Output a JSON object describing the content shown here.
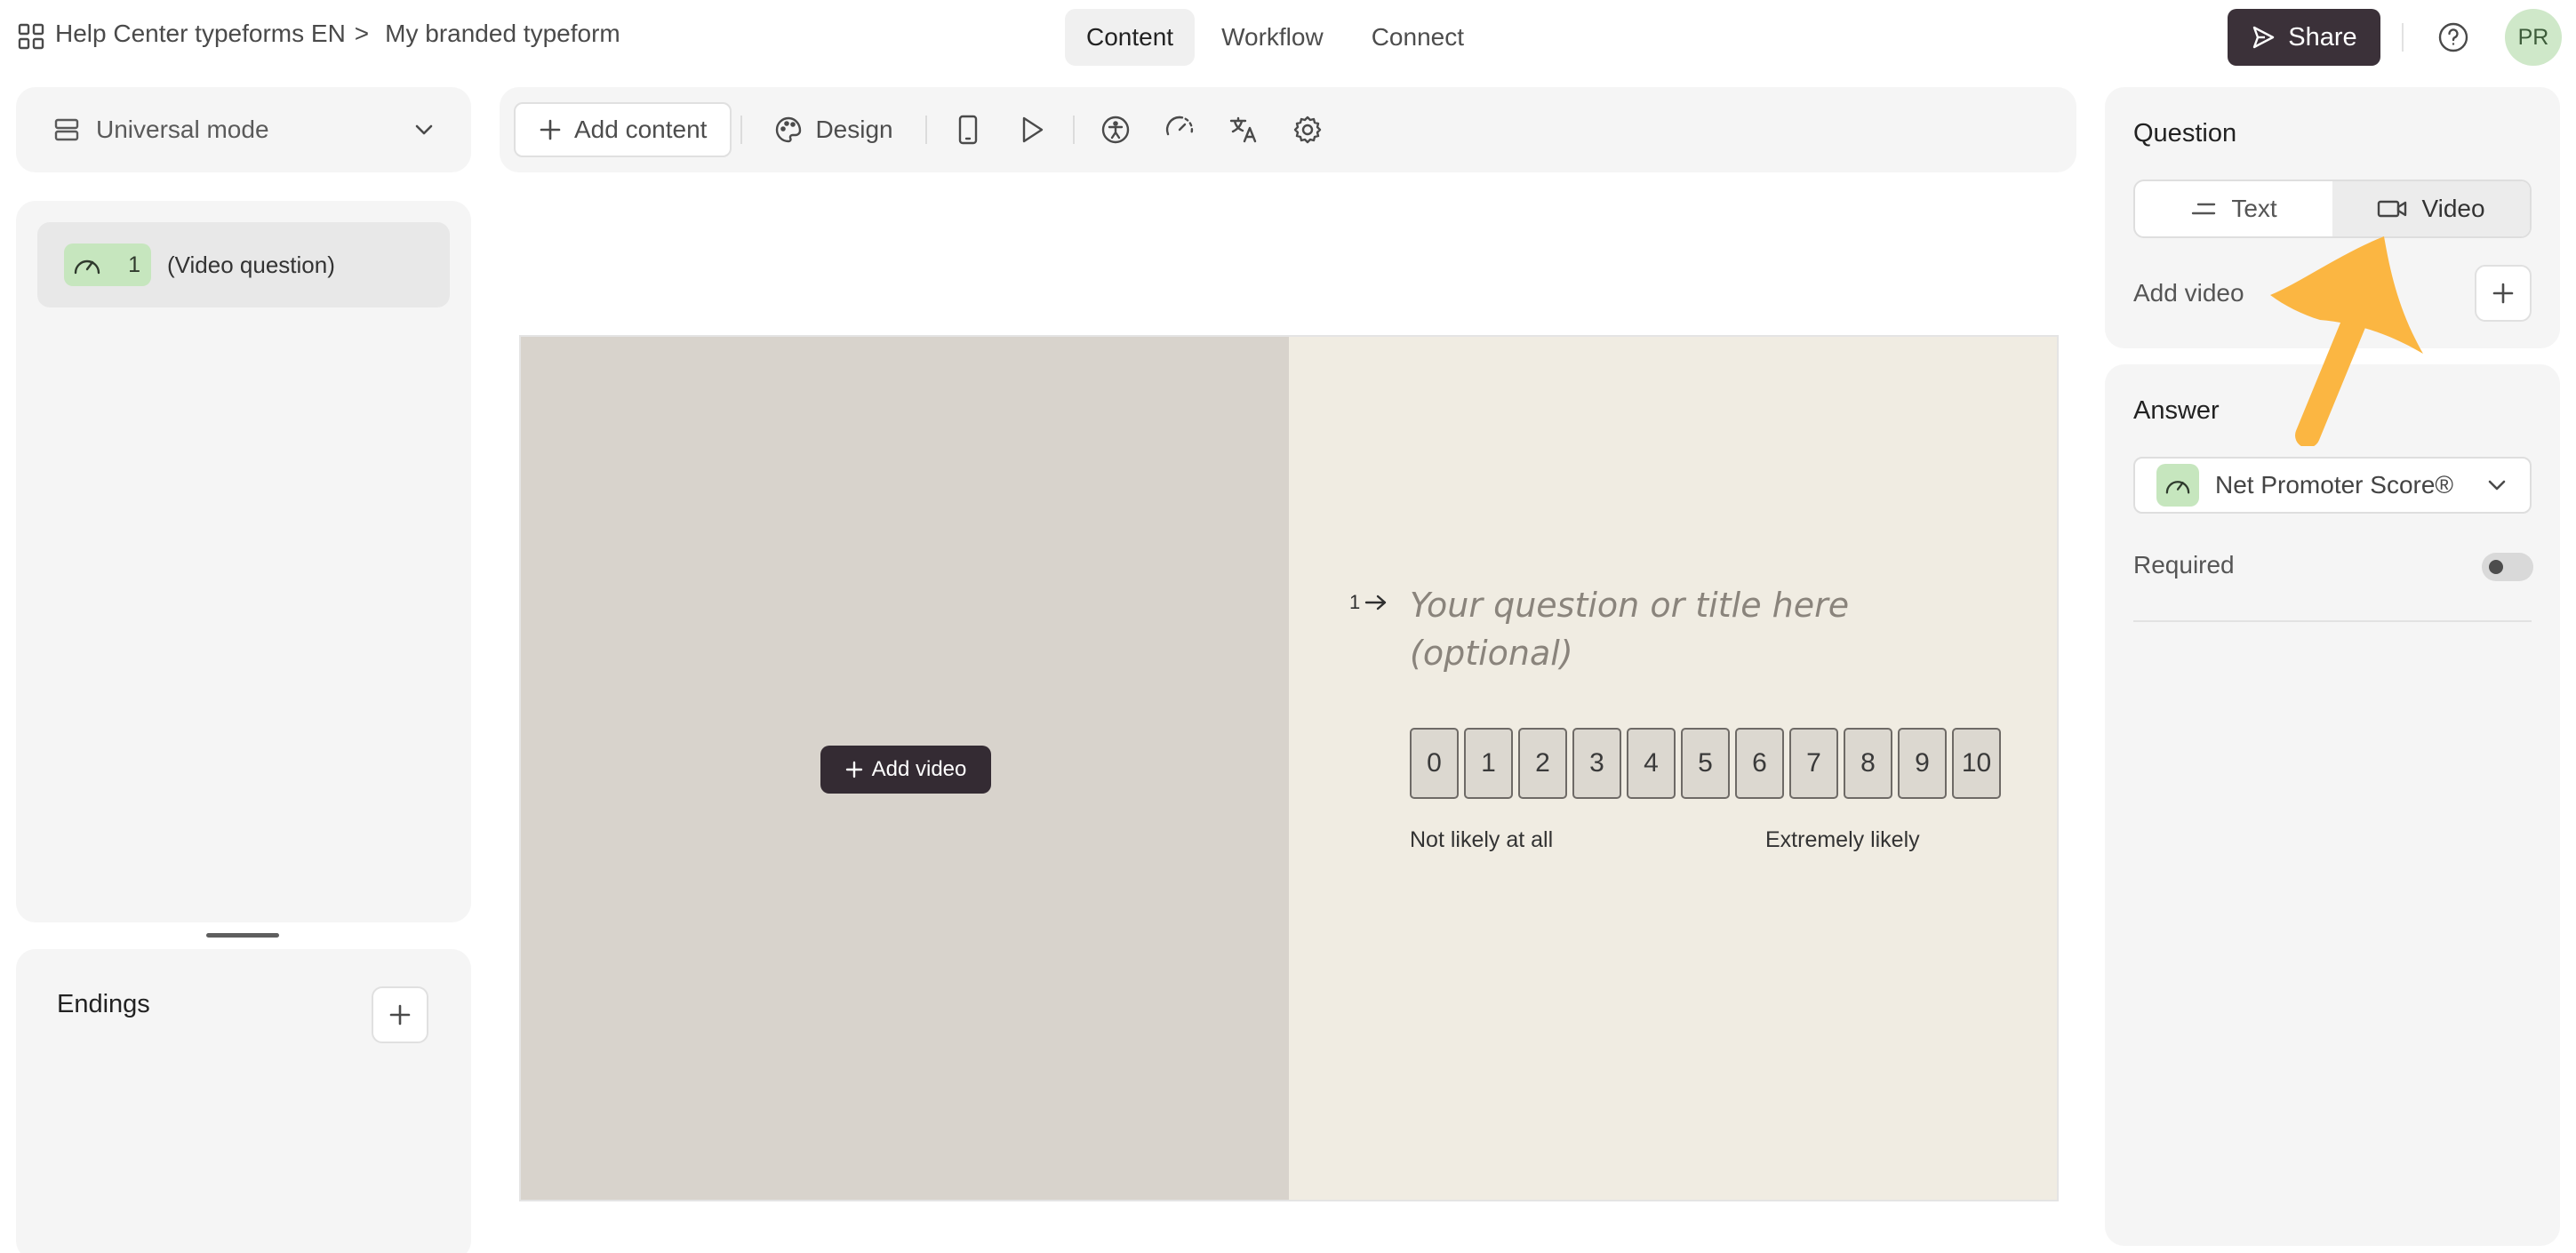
{
  "header": {
    "workspace": "Help Center typeforms EN",
    "separator": ">",
    "form_name": "My branded typeform",
    "tabs": [
      {
        "label": "Content",
        "active": true
      },
      {
        "label": "Workflow",
        "active": false
      },
      {
        "label": "Connect",
        "active": false
      }
    ],
    "share_label": "Share",
    "avatar_initials": "PR"
  },
  "left_panel": {
    "mode_label": "Universal mode",
    "questions": [
      {
        "number": "1",
        "label": "(Video question)"
      }
    ],
    "endings_label": "Endings"
  },
  "toolbar": {
    "add_content_label": "Add content",
    "design_label": "Design"
  },
  "canvas": {
    "add_video_label": "Add video",
    "question_number": "1",
    "question_placeholder": "Your question or title here (optional)",
    "scale": [
      "0",
      "1",
      "2",
      "3",
      "4",
      "5",
      "6",
      "7",
      "8",
      "9",
      "10"
    ],
    "label_low": "Not likely at all",
    "label_high": "Extremely likely"
  },
  "right_panel": {
    "question_title": "Question",
    "text_option": "Text",
    "video_option": "Video",
    "add_video_label": "Add video",
    "answer_title": "Answer",
    "answer_type": "Net Promoter Score®",
    "required_label": "Required"
  },
  "colors": {
    "accent_dark": "#3b3139",
    "nps_green": "#c6e6be",
    "annotation_arrow": "#fbb642",
    "canvas_left": "#d8d3cc",
    "canvas_right": "#f0ece2"
  }
}
